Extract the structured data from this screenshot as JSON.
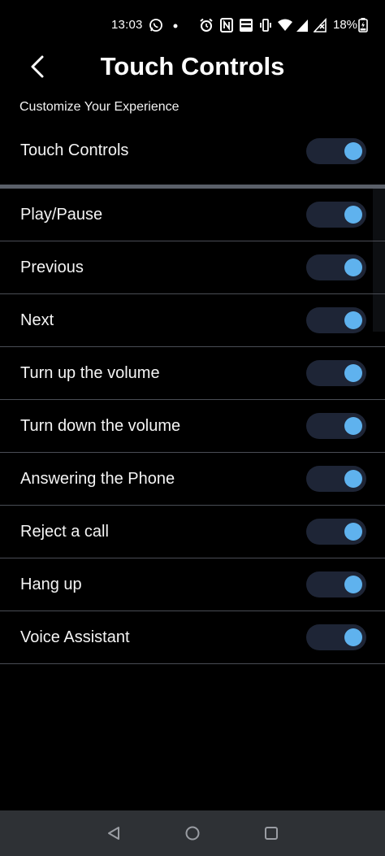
{
  "status_bar": {
    "time": "13:03",
    "battery": "18%",
    "icons": [
      "whatsapp-icon",
      "dot-icon",
      "alarm-icon",
      "nfc-icon",
      "volte-icon",
      "vibrate-icon",
      "wifi-icon",
      "signal-icon",
      "no-signal-icon",
      "battery-charging-icon"
    ]
  },
  "header": {
    "title": "Touch Controls",
    "back_icon": "chevron-left-icon"
  },
  "subtitle": "Customize Your Experience",
  "master": {
    "label": "Touch Controls",
    "enabled": true
  },
  "items": [
    {
      "label": "Play/Pause",
      "enabled": true
    },
    {
      "label": "Previous",
      "enabled": true
    },
    {
      "label": "Next",
      "enabled": true
    },
    {
      "label": "Turn up the volume",
      "enabled": true
    },
    {
      "label": "Turn down the volume",
      "enabled": true
    },
    {
      "label": "Answering the Phone",
      "enabled": true
    },
    {
      "label": "Reject a call",
      "enabled": true
    },
    {
      "label": "Hang up",
      "enabled": true
    },
    {
      "label": "Voice Assistant",
      "enabled": true
    }
  ],
  "nav_bar": {
    "icons": [
      "back-triangle-icon",
      "home-circle-icon",
      "recents-square-icon"
    ]
  },
  "colors": {
    "background": "#000000",
    "toggle_track": "#1e2536",
    "toggle_knob": "#5fb2ee",
    "divider": "#4a4d55",
    "nav_bar": "#2e3135"
  }
}
